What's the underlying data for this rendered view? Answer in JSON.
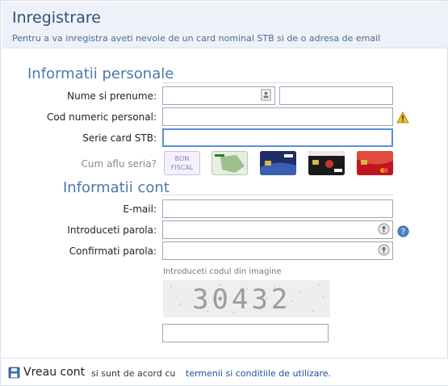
{
  "header": {
    "title": "Inregistrare",
    "subtitle": "Pentru a va inregistra aveti nevoie de un card nominal STB si de o adresa de email"
  },
  "personal": {
    "section_title": "Informatii personale",
    "name_label": "Nume si prenume:",
    "cnp_label": "Cod numeric personal:",
    "serie_label": "Serie card STB:",
    "help_label": "Cum aflu seria?",
    "bon_label_1": "BON",
    "bon_label_2": "FISCAL"
  },
  "account": {
    "section_title": "Informatii cont",
    "email_label": "E-mail:",
    "password_label": "Introduceti parola:",
    "confirm_label": "Confirmati parola:"
  },
  "captcha": {
    "label": "Introduceti codul din imagine",
    "code": "30432"
  },
  "footer": {
    "button_label": "Vreau cont",
    "text": "si sunt de acord cu",
    "link": "termenii si conditiile de utilizare."
  },
  "icons": {
    "id_card": "id-card-icon",
    "warning": "warning-icon",
    "password_eye": "password-reveal-icon",
    "help": "help-icon",
    "save": "save-icon"
  },
  "colors": {
    "accent": "#4a78ae",
    "title": "#2d4f7a",
    "link": "#1a4f96",
    "active_border": "#5b8fd6"
  }
}
